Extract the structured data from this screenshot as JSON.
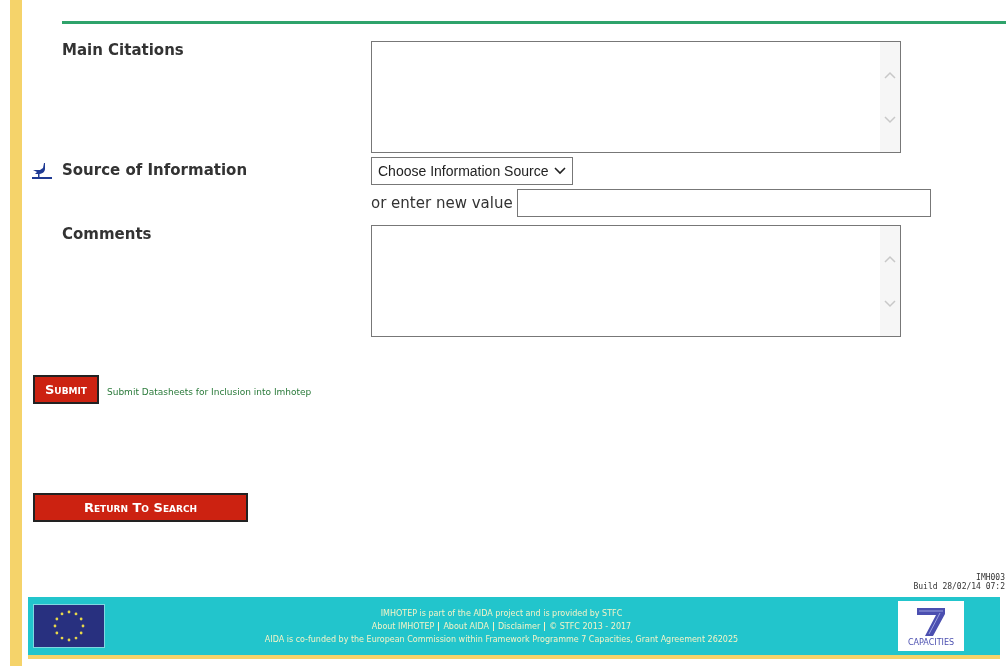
{
  "fields": [
    {
      "kind": "textarea",
      "label": "Main Citations",
      "icon": false
    },
    {
      "kind": "select",
      "label": "Source of Information",
      "icon": true,
      "select_value": "Choose Information Source",
      "alt_label": "or enter new value"
    },
    {
      "kind": "textarea",
      "label": "Comments",
      "icon": false
    }
  ],
  "submit": {
    "button": "Submit",
    "caption": "Submit Datasheets for Inclusion into Imhotep"
  },
  "return_button": "Return To Search",
  "build": [
    "IMH003",
    "Build 28/02/14 07:2"
  ],
  "footer": {
    "line1": "IMHOTEP is part of the AIDA project and is provided by STFC",
    "links": [
      "About IMHOTEP",
      "About AIDA",
      "Disclaimer"
    ],
    "copyright": "© STFC 2013 - 2017",
    "line3": "AIDA is co-funded by the European Commission within Framework Programme 7 Capacities, Grant Agreement 262025",
    "logo_caption": "CAPACITIES"
  }
}
